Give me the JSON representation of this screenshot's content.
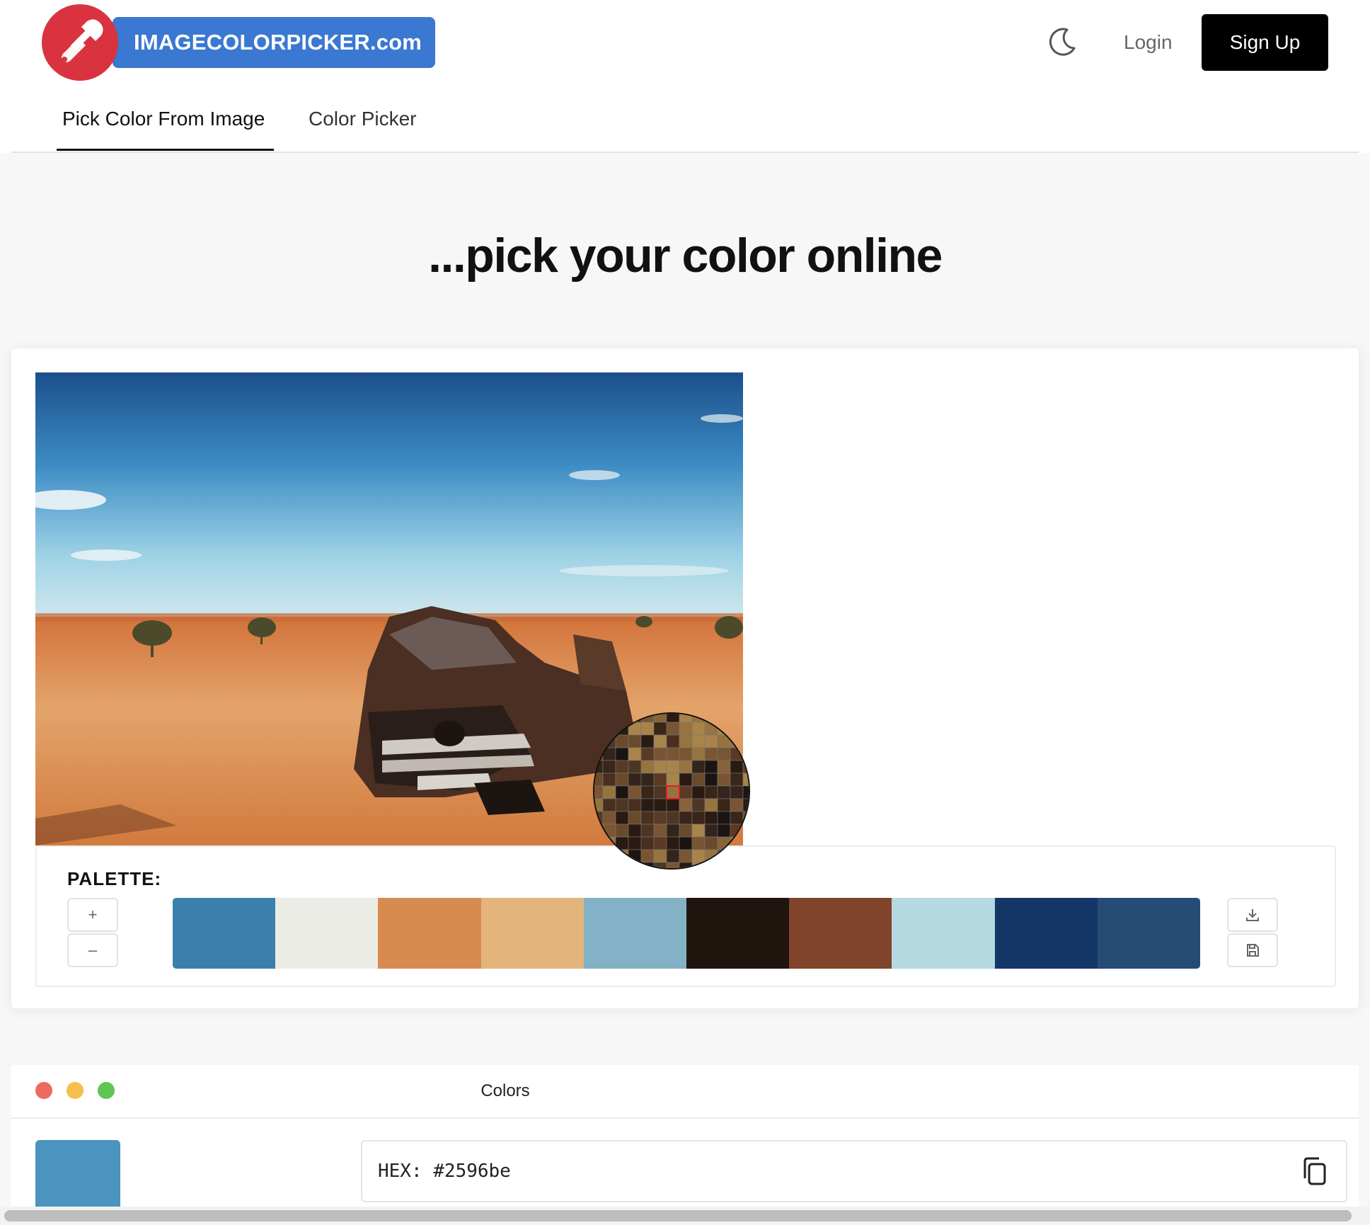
{
  "header": {
    "logo_text": "IMAGECOLORPICKER.com",
    "login_label": "Login",
    "signup_label": "Sign Up",
    "theme_icon": "moon-icon"
  },
  "tabs": [
    {
      "label": "Pick Color From Image",
      "active": true
    },
    {
      "label": "Color Picker",
      "active": false
    }
  ],
  "headline": "...pick your color online",
  "palette": {
    "label": "PALETTE:",
    "add_icon": "+",
    "remove_icon": "–",
    "colors": [
      "#3b80ad",
      "#ecece6",
      "#d88b4f",
      "#e3b57c",
      "#83b1c5",
      "#20140f",
      "#7f442a",
      "#b4d9e1",
      "#153768",
      "#254c75"
    ],
    "side_icons": [
      "download-icon",
      "save-icon"
    ]
  },
  "colors_window": {
    "title": "Colors",
    "traffic_lights": [
      "#ec6a5e",
      "#f4bf4f",
      "#61c554"
    ],
    "selected_color": "#4a94bf",
    "hex_label": "HEX:",
    "hex_value": "#2596be",
    "hex_display": "HEX: #2596be"
  }
}
